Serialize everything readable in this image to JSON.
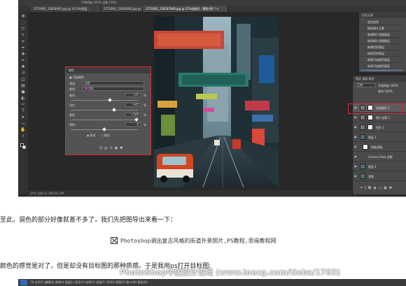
{
  "ps_top": {
    "options_bar": "不透明度:100%   流量:100%",
    "tabs": [
      "2751892_12818491.jpg @ 33.3%(图层...",
      "2751892_12818484.jpg @ 25%(色彩...",
      "2751892_128187849.jpg @ 25%(曲线1...蒙版)/8) * ×"
    ],
    "status": "25%    文档:12.2M/101.2M",
    "properties_panel": {
      "title": "属性",
      "header": "可选颜色",
      "preset_label": "预设:",
      "preset_value": "自定",
      "colors_label": "颜色:",
      "colors_value": "洋红",
      "sliders": [
        {
          "label": "青色:",
          "value": "+33",
          "fraction": 0.58
        },
        {
          "label": "洋红:",
          "value": "+45",
          "fraction": 0.65
        },
        {
          "label": "黄色:",
          "value": "+100",
          "fraction": 0.98
        },
        {
          "label": "黑色:",
          "value": "0",
          "fraction": 0.5
        }
      ],
      "unit": "%",
      "method_relative": "相对",
      "method_absolute": "绝对"
    },
    "history_panel": {
      "title": "历史记录",
      "items": [
        "混合选项",
        "移除图片元素",
        "新建照片滤镜图层",
        "修改照片滤镜图层",
        "新建色阶图层",
        "修改色阶图层",
        "新建可选颜色图层",
        "修改可选颜色图层",
        "修改可选颜色图层"
      ]
    },
    "layers_panel": {
      "tabs": "图层  通道  路径",
      "blend_mode": "正常",
      "opacity": "不透明度:100%",
      "fill": "填充:100%",
      "layers": [
        "选取颜色 1",
        "照片滤镜 1",
        "色阶 1",
        "图层 1",
        "智能滤镜",
        "Camera Raw 滤镜",
        "图层 1",
        "背景"
      ]
    }
  },
  "article": {
    "para1": "至此，调色的部分好像就差不多了，我们先把图导出来看一下：",
    "image_caption": "Photoshop调出复古风格的街道外景照片,PS教程,思缘教程网",
    "para2": "颜色的感觉是对了，但是却没有目标图的那种质感。于是我用ps打开目标图:",
    "watermark": "PhotoShop中国设计论坛 (www.lnecg.com/tieba/1783)"
  },
  "ps_bottom": {
    "menu": "PS  文件(F)  编辑(E)  图像(I)  图层(L)  类型(Y)  选择(S)  滤镜(T)  3D(D)  视图(V)  窗口(W)  帮助(H)"
  },
  "colors": {
    "highlight_red": "#d9272e",
    "ps_dark": "#282828",
    "panel": "#535353"
  }
}
